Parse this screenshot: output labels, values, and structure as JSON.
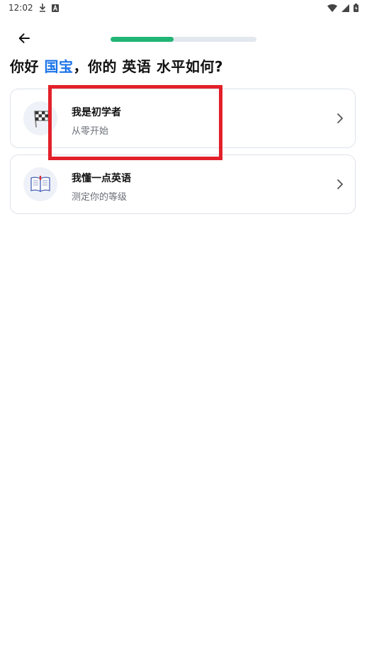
{
  "status_bar": {
    "time": "12:02",
    "left_icons": [
      "download-icon",
      "font-icon"
    ],
    "right_icons": [
      "wifi-icon",
      "signal-icon",
      "battery-icon"
    ]
  },
  "header": {
    "back_icon": "arrow-left-icon",
    "progress": 0.43,
    "progress_color": "#20b574"
  },
  "question": {
    "prefix": "你好 ",
    "name": "国宝",
    "suffix": "，你的 英语 水平如何?"
  },
  "options": [
    {
      "title": "我是初学者",
      "subtitle": "从零开始",
      "icon": "checkered-flag-icon"
    },
    {
      "title": "我懂一点英语",
      "subtitle": "测定你的等级",
      "icon": "open-book-icon"
    }
  ],
  "colors": {
    "accent": "#1a73e8",
    "highlight_box": "#e3202a"
  }
}
